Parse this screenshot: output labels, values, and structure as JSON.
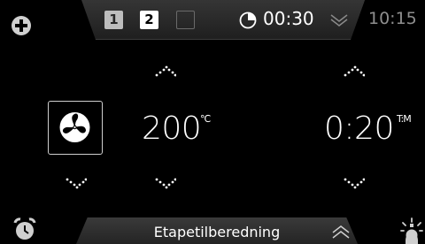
{
  "colors": {
    "background": "#000000",
    "text_primary": "#ffffff",
    "text_dim": "#8e8e8e",
    "tab_fill": "#2a2a2a",
    "stage_active": "#ffffff",
    "stage_done": "#bdbdbd"
  },
  "top_bar": {
    "add_icon": "plus-circle-icon",
    "stages": [
      {
        "label": "1",
        "state": "completed"
      },
      {
        "label": "2",
        "state": "active"
      },
      {
        "label": "",
        "state": "empty"
      }
    ],
    "timer_icon": "timer-pie-icon",
    "timer": "00:30",
    "expand_icon": "chevron-double-down-icon",
    "clock": "10:15"
  },
  "settings": {
    "mode_icon": "fan-icon",
    "temperature": {
      "value": "200",
      "unit": "℃"
    },
    "duration": {
      "value": "0:20",
      "unit": "T:M"
    }
  },
  "bottom_bar": {
    "alarm_icon": "alarm-clock-icon",
    "label": "Etapetilberedning",
    "collapse_icon": "chevron-double-up-icon",
    "lamp_icon": "oven-light-icon"
  }
}
